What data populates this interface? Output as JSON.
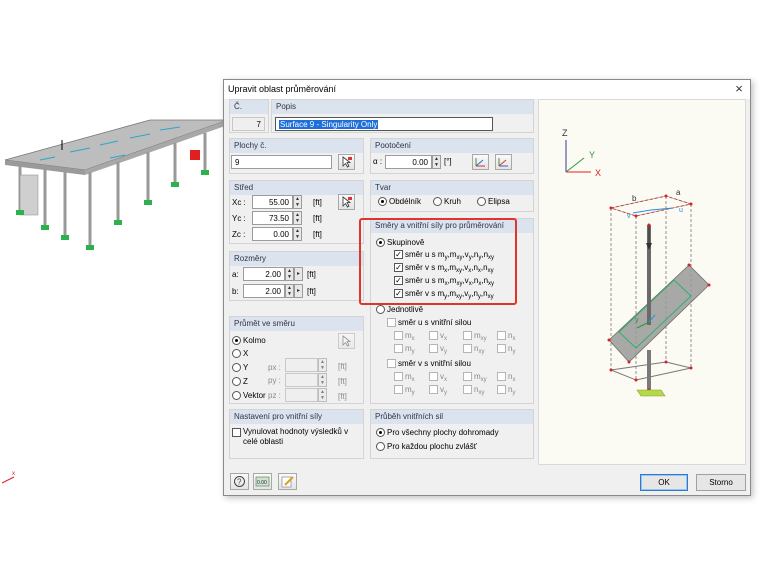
{
  "dialog": {
    "title": "Upravit oblast průměrování",
    "close_glyph": "×"
  },
  "number": {
    "label": "Č.",
    "value": "7"
  },
  "description": {
    "label": "Popis",
    "value": "Surface 9 - Singularity Only"
  },
  "surfaces": {
    "label": "Plochy č.",
    "value": "9"
  },
  "rotation": {
    "label": "Pootočení",
    "alpha_label": "α :",
    "value": "0.00",
    "unit": "[°]"
  },
  "center": {
    "label": "Střed",
    "xc_label": "Xc :",
    "xc_value": "55.00",
    "xc_unit": "[ft]",
    "yc_label": "Yc :",
    "yc_value": "73.50",
    "yc_unit": "[ft]",
    "zc_label": "Zc :",
    "zc_value": "0.00",
    "zc_unit": "[ft]"
  },
  "shape": {
    "label": "Tvar",
    "rectangle": "Obdélník",
    "circle": "Kruh",
    "ellipse": "Elipsa",
    "selected": "rectangle"
  },
  "dimensions": {
    "label": "Rozměry",
    "a_label": "a:",
    "a_value": "2.00",
    "a_unit": "[ft]",
    "b_label": "b:",
    "b_value": "2.00",
    "b_unit": "[ft]"
  },
  "directions": {
    "label": "Směry a vnitřní síly pro průměrování",
    "grouped": "Skupinově",
    "group_items": [
      {
        "prefix": "směr v s m",
        "parts": [
          [
            "y",
            ""
          ],
          [
            "m",
            ""
          ],
          [
            "xy",
            ""
          ],
          [
            "v",
            "y"
          ],
          [
            "n",
            ""
          ],
          [
            "y",
            ""
          ],
          [
            "n",
            "xy"
          ]
        ],
        "text": "směr u s my,mxy,vy,ny,nxy"
      },
      {
        "text": "směr v s mx,mxy,vx,nx,nxy"
      },
      {
        "text": "směr u s mx,mxy,vx,nx,nxy"
      },
      {
        "text": "směr v s my,mxy,vy,ny,nxy"
      }
    ],
    "group_rows": [
      {
        "pre": "směr u s m",
        "subs": [
          "y",
          ",m",
          "xy",
          ",v",
          "y",
          ",n",
          "y",
          ",n",
          "xy"
        ]
      },
      {
        "pre": "směr v s m",
        "subs": [
          "x",
          ",m",
          "xy",
          ",v",
          "x",
          ",n",
          "x",
          ",n",
          "xy"
        ]
      },
      {
        "pre": "směr u s m",
        "subs": [
          "x",
          ",m",
          "xy",
          ",v",
          "x",
          ",n",
          "x",
          ",n",
          "xy"
        ]
      },
      {
        "pre": "směr v s m",
        "subs": [
          "y",
          ",m",
          "xy",
          ",v",
          "y",
          ",n",
          "y",
          ",n",
          "xy"
        ]
      }
    ],
    "individual": "Jednotlivě",
    "u_forces": "směr u s vnitřní silou",
    "v_forces": "směr v s vnitřní silou",
    "force_labels": [
      "mx",
      "vx",
      "mxy",
      "nx",
      "my",
      "vy",
      "nxy",
      "ny"
    ]
  },
  "projection": {
    "label": "Průmět ve směru",
    "perpendicular": "Kolmo",
    "x": "X",
    "y": "Y",
    "z": "Z",
    "vector": "Vektor",
    "px_label": "px :",
    "py_label": "py :",
    "pz_label": "pz :",
    "unit": "[ft]"
  },
  "internal_forces_settings": {
    "label": "Nastavení pro vnitřní síly",
    "reset_text": "Vynulovat hodnoty výsledků v celé oblasti"
  },
  "distribution": {
    "label": "Průběh vnitřních sil",
    "all_surfaces": "Pro všechny plochy dohromady",
    "each_surface": "Pro každou plochu zvlášť"
  },
  "preview_axes": {
    "z": "Z",
    "y": "Y",
    "x": "X",
    "a": "a",
    "b": "b",
    "u": "u",
    "v": "v"
  },
  "footer": {
    "ok": "OK",
    "cancel": "Storno",
    "units_icon_text": "0.00"
  },
  "colors": {
    "highlight": "#e0352b",
    "group_header": "#dbe3ee",
    "field_selected": "#1e6fd9"
  }
}
